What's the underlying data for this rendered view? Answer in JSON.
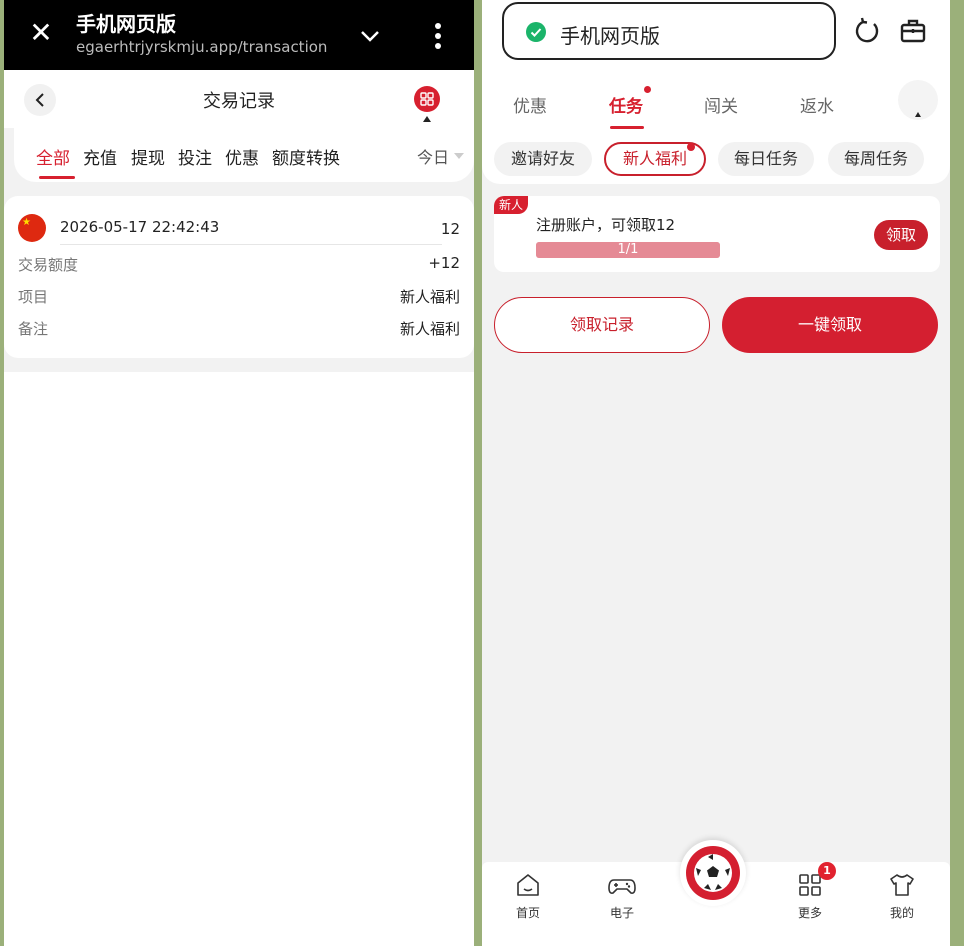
{
  "left": {
    "browser": {
      "title": "手机网页版",
      "url": "egaerhtrjyrskmju.app/transaction"
    },
    "header": {
      "title": "交易记录"
    },
    "tabs": [
      {
        "label": "全部",
        "active": true
      },
      {
        "label": "充值",
        "active": false
      },
      {
        "label": "提现",
        "active": false
      },
      {
        "label": "投注",
        "active": false
      },
      {
        "label": "优惠",
        "active": false
      },
      {
        "label": "额度转换",
        "active": false
      }
    ],
    "date_filter": "今日",
    "record": {
      "datetime": "2026-05-17 22:42:43",
      "amount": "12",
      "rows": [
        {
          "label": "交易额度",
          "value": "+12"
        },
        {
          "label": "项目",
          "value": "新人福利"
        },
        {
          "label": "备注",
          "value": "新人福利"
        }
      ]
    }
  },
  "right": {
    "browser": {
      "title": "手机网页版"
    },
    "tabs": [
      {
        "label": "优惠",
        "active": false
      },
      {
        "label": "任务",
        "active": true
      },
      {
        "label": "闯关",
        "active": false
      },
      {
        "label": "返水",
        "active": false
      }
    ],
    "chips": [
      {
        "label": "邀请好友",
        "active": false
      },
      {
        "label": "新人福利",
        "active": true
      },
      {
        "label": "每日任务",
        "active": false
      },
      {
        "label": "每周任务",
        "active": false
      }
    ],
    "task": {
      "badge": "新人",
      "description": "注册账户，可领取12",
      "progress_text": "1/1",
      "progress_fraction": 1.0,
      "claim_label": "领取"
    },
    "actions": {
      "records_label": "领取记录",
      "claim_all_label": "一键领取"
    },
    "bottom_nav": [
      {
        "label": "首页",
        "icon": "home-icon"
      },
      {
        "label": "电子",
        "icon": "gamepad-icon"
      },
      {
        "label": "更多",
        "icon": "grid-icon",
        "badge": "1"
      },
      {
        "label": "我的",
        "icon": "shirt-icon"
      }
    ]
  },
  "colors": {
    "brand_red": "#d41f30",
    "progress_bg": "#f0cdd0",
    "progress_fill": "#e58a95",
    "secure_green": "#1bb46a"
  }
}
